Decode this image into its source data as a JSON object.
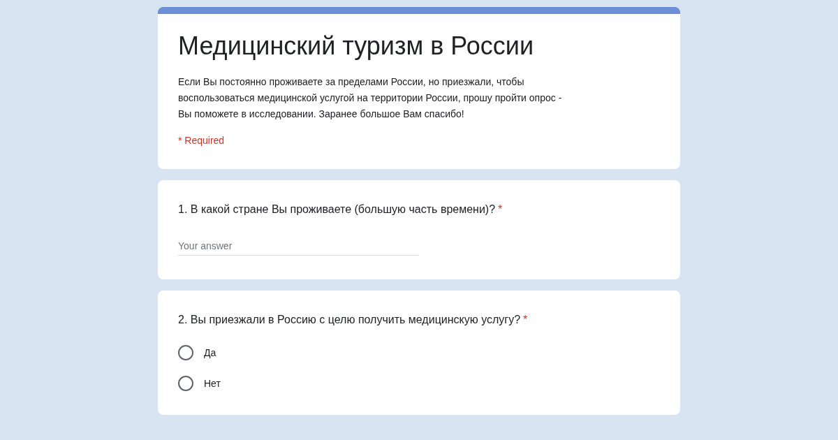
{
  "form": {
    "title": "Медицинский туризм в России",
    "description": "Если Вы постоянно проживаете за пределами России, но приезжали, чтобы\nвоспользоваться медицинской услугой на территории России, прошу пройти опрос -\nВы  поможете в исследовании. Заранее большое Вам спасибо!",
    "required_note": "* Required"
  },
  "questions": [
    {
      "kind": "text",
      "title": "1. В какой стране Вы проживаете (большую часть времени)?",
      "required_mark": "*",
      "placeholder": "Your answer"
    },
    {
      "kind": "radio",
      "title": "2. Вы приезжали в Россию с целю получить медицинскую услугу?",
      "required_mark": "*",
      "options": [
        {
          "label": "Да",
          "selected": false
        },
        {
          "label": "Нет",
          "selected": false
        }
      ]
    }
  ]
}
